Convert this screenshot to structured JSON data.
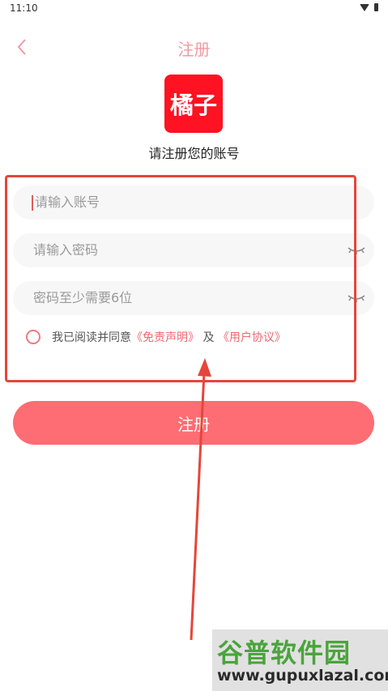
{
  "status_bar": {
    "time": "11:10"
  },
  "header": {
    "title": "注册"
  },
  "logo": {
    "text": "橘子"
  },
  "subtitle": "请注册您的账号",
  "form": {
    "account_placeholder": "请输入账号",
    "password_placeholder": "请输入密码",
    "confirm_placeholder": "密码至少需要6位"
  },
  "agreement": {
    "prefix": "我已阅读并同意",
    "disclaimer": "《免责声明》",
    "and": "及",
    "user_agreement": "《用户协议》"
  },
  "register_button": "注册",
  "watermark": {
    "logo": "谷普软件园",
    "url": "www.gupuxlazal.com"
  },
  "colors": {
    "accent": "#fe6d73",
    "logo_bg": "#ff1221",
    "annotation": "#e5463a"
  }
}
